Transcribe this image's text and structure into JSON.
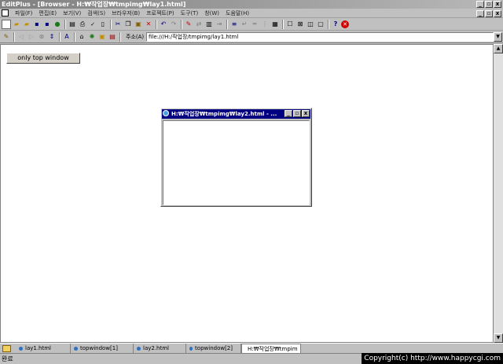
{
  "app": {
    "title": "EditPlus - [Browser - H:₩작업장₩tmpimg₩lay1.html]"
  },
  "window_controls": {
    "minimize": "_",
    "maximize": "▫",
    "close": "x"
  },
  "menu": {
    "items": [
      "파일(F)",
      "편집(E)",
      "보기(V)",
      "검색(S)",
      "브라우저(B)",
      "프로젝트(P)",
      "도구(T)",
      "창(W)",
      "도움말(H)"
    ]
  },
  "address": {
    "label": "주소(A)",
    "value": "file:///H:/작업장/tmpimg/lay1.html"
  },
  "page": {
    "button_label": "only top window"
  },
  "popup": {
    "title": "H:₩작업장₩tmpimg₩lay2.html - ..."
  },
  "tabs": [
    {
      "label": "lay1.html",
      "active": false
    },
    {
      "label": "topwindow[1]",
      "active": false
    },
    {
      "label": "lay2.html",
      "active": false
    },
    {
      "label": "topwindow[2]",
      "active": false
    },
    {
      "label": "H:₩작업장₩tmpim",
      "active": true
    }
  ],
  "status": {
    "text": "완료"
  },
  "watermark": {
    "text": "Copyright(c) http://www.happycgi.com"
  }
}
